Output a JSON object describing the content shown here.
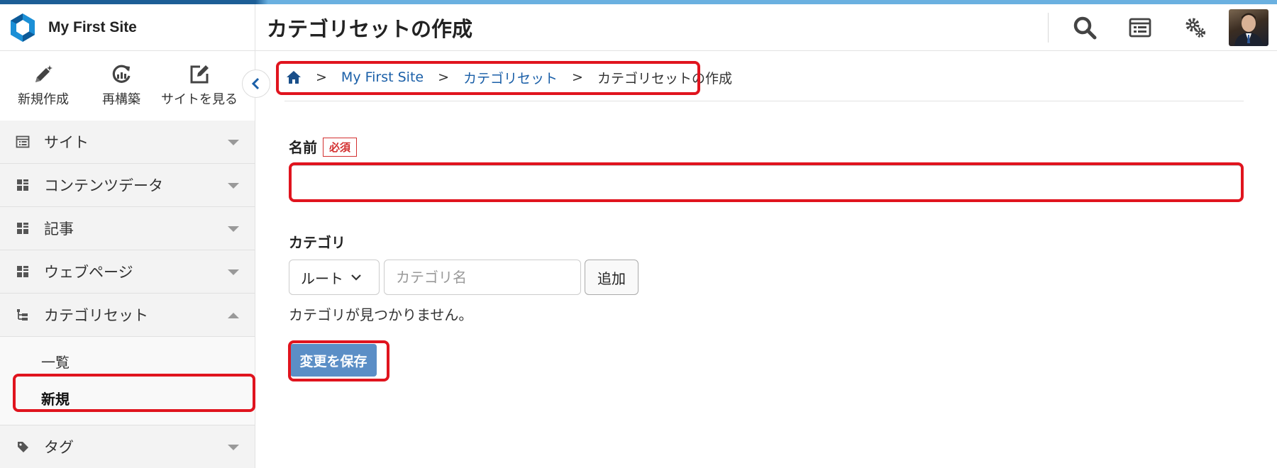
{
  "site": {
    "name": "My First Site"
  },
  "page": {
    "title": "カテゴリセットの作成"
  },
  "header": {
    "icons": [
      "search-icon",
      "dashboard-icon",
      "settings-icon",
      "user-avatar"
    ]
  },
  "quick_actions": [
    {
      "label": "新規作成",
      "icon": "pencil-sparkle-icon"
    },
    {
      "label": "再構築",
      "icon": "rebuild-icon"
    },
    {
      "label": "サイトを見る",
      "icon": "external-edit-icon"
    }
  ],
  "sidebar": {
    "items": [
      {
        "label": "サイト",
        "icon": "site-icon",
        "expanded": false
      },
      {
        "label": "コンテンツデータ",
        "icon": "grid-icon",
        "expanded": false
      },
      {
        "label": "記事",
        "icon": "grid-icon",
        "expanded": false
      },
      {
        "label": "ウェブページ",
        "icon": "grid-icon",
        "expanded": false
      },
      {
        "label": "カテゴリセット",
        "icon": "tree-icon",
        "expanded": true
      },
      {
        "label": "タグ",
        "icon": "tag-icon",
        "expanded": false
      }
    ],
    "sub_items": [
      {
        "label": "一覧",
        "active": false
      },
      {
        "label": "新規",
        "active": true
      }
    ]
  },
  "breadcrumb": {
    "home_icon": "home-icon",
    "separator": ">",
    "items": [
      "My First Site",
      "カテゴリセット",
      "カテゴリセットの作成"
    ]
  },
  "form": {
    "name_label": "名前",
    "required_badge": "必須",
    "name_value": "",
    "category_label": "カテゴリ",
    "parent_select": "ルート",
    "category_placeholder": "カテゴリ名",
    "add_button": "追加",
    "empty_message": "カテゴリが見つかりません。",
    "save_button": "変更を保存"
  },
  "colors": {
    "highlight": "#e0141e",
    "link": "#1a5fa8",
    "primary_button": "#5b8ec6",
    "required": "#d32f2f"
  }
}
